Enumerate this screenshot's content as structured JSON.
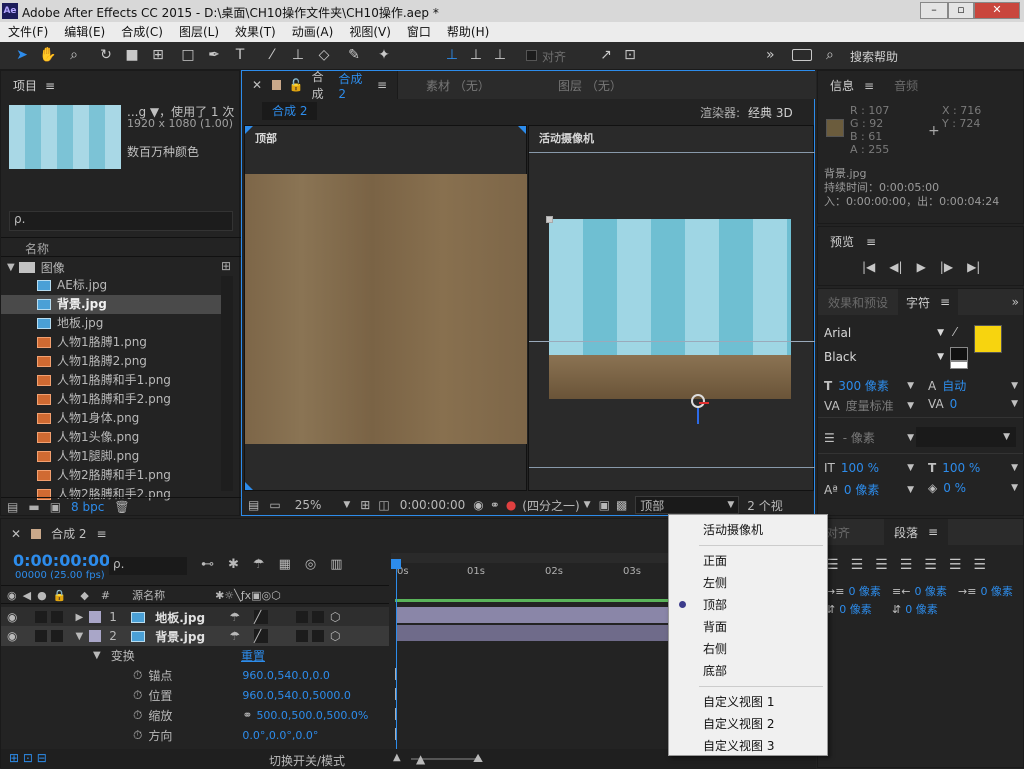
{
  "window": {
    "title": "Adobe After Effects CC 2015 - D:\\桌面\\CH10操作文件夹\\CH10操作.aep *",
    "logo": "Ae"
  },
  "menu": [
    "文件(F)",
    "编辑(E)",
    "合成(C)",
    "图层(L)",
    "效果(T)",
    "动画(A)",
    "视图(V)",
    "窗口",
    "帮助(H)"
  ],
  "toolbar": {
    "align_label": "对齐",
    "search_label": "搜索帮助",
    "more": "»"
  },
  "project": {
    "title": "项目",
    "item_name": "...g ▼，使用了 1 次",
    "item_dims": "1920 x 1080 (1.00)",
    "item_color": "数百万种颜色",
    "search_placeholder": "ρ.",
    "col_name": "名称",
    "folder": "图像",
    "files": [
      {
        "name": "AE标.jpg",
        "type": "jpg"
      },
      {
        "name": "背景.jpg",
        "type": "jpg",
        "selected": true
      },
      {
        "name": "地板.jpg",
        "type": "jpg"
      },
      {
        "name": "人物1胳膊1.png",
        "type": "png"
      },
      {
        "name": "人物1胳膊2.png",
        "type": "png"
      },
      {
        "name": "人物1胳膊和手1.png",
        "type": "png"
      },
      {
        "name": "人物1胳膊和手2.png",
        "type": "png"
      },
      {
        "name": "人物1身体.png",
        "type": "png"
      },
      {
        "name": "人物1头像.png",
        "type": "png"
      },
      {
        "name": "人物1腿脚.png",
        "type": "png"
      },
      {
        "name": "人物2胳膊和手1.png",
        "type": "png"
      },
      {
        "name": "人物2胳膊和手2.png",
        "type": "png"
      }
    ],
    "bpc": "8 bpc"
  },
  "comp_viewer": {
    "tab_prefix": "合成",
    "tab_name": "合成 2",
    "footage_tab": "素材 （无）",
    "layer_tab": "图层 （无）",
    "breadcrumb": "合成 2",
    "renderer_label": "渲染器:",
    "renderer_value": "经典 3D",
    "left_view_label": "顶部",
    "right_view_label": "活动摄像机",
    "zoom": "25%",
    "timecode": "0:00:00:00",
    "resolution": "(四分之一)",
    "view_select": "顶部",
    "view_count": "2 个视"
  },
  "view_menu": {
    "items": [
      "活动摄像机",
      "正面",
      "左侧",
      "顶部",
      "背面",
      "右侧",
      "底部",
      "自定义视图 1",
      "自定义视图 2",
      "自定义视图 3"
    ],
    "selected": "顶部"
  },
  "info": {
    "tab": "信息",
    "audio_tab": "音频",
    "r": "R : 107",
    "g": "G : 92",
    "b": "B : 61",
    "a": "A : 255",
    "x": "X : 716",
    "y": "Y : 724",
    "swatch_color": "#6b5c3d",
    "layer_name": "背景.jpg",
    "duration": "持续时间：0:00:05:00",
    "inout": "入：0:00:00:00，出：0:00:04:24"
  },
  "preview": {
    "tab": "预览"
  },
  "character": {
    "effects_tab": "效果和预设",
    "char_tab": "字符",
    "font": "Arial",
    "style": "Black",
    "size": "300 像素",
    "leading": "自动",
    "kerning": "度量标准",
    "tracking": "0",
    "stroke": "- 像素",
    "vscale": "100 %",
    "hscale": "100 %",
    "baseline": "0 像素",
    "tsume": "0 %",
    "fill_color": "#f7d40f"
  },
  "paragraph": {
    "align_tab": "对齐",
    "para_tab": "段落",
    "indent_left": "0 像素",
    "indent_first": "0 像素",
    "indent_right": "0 像素",
    "space_before": "0 像素",
    "space_after": "0 像素"
  },
  "timeline": {
    "tab": "合成 2",
    "timecode": "0:00:00:00",
    "frames": "00000 (25.00 fps)",
    "col_source": "源名称",
    "col_num": "#",
    "ruler": [
      "0s",
      "01s",
      "02s",
      "03s"
    ],
    "layers": [
      {
        "num": "1",
        "name": "地板.jpg"
      },
      {
        "num": "2",
        "name": "背景.jpg"
      }
    ],
    "transform": "变换",
    "reset": "重置",
    "props": [
      {
        "name": "锚点",
        "value": "960.0,540.0,0.0"
      },
      {
        "name": "位置",
        "value": "960.0,540.0,5000.0"
      },
      {
        "name": "缩放",
        "value": "500.0,500.0,500.0%"
      },
      {
        "name": "方向",
        "value": "0.0°,0.0°,0.0°"
      }
    ],
    "toggle_label": "切换开关/模式"
  }
}
